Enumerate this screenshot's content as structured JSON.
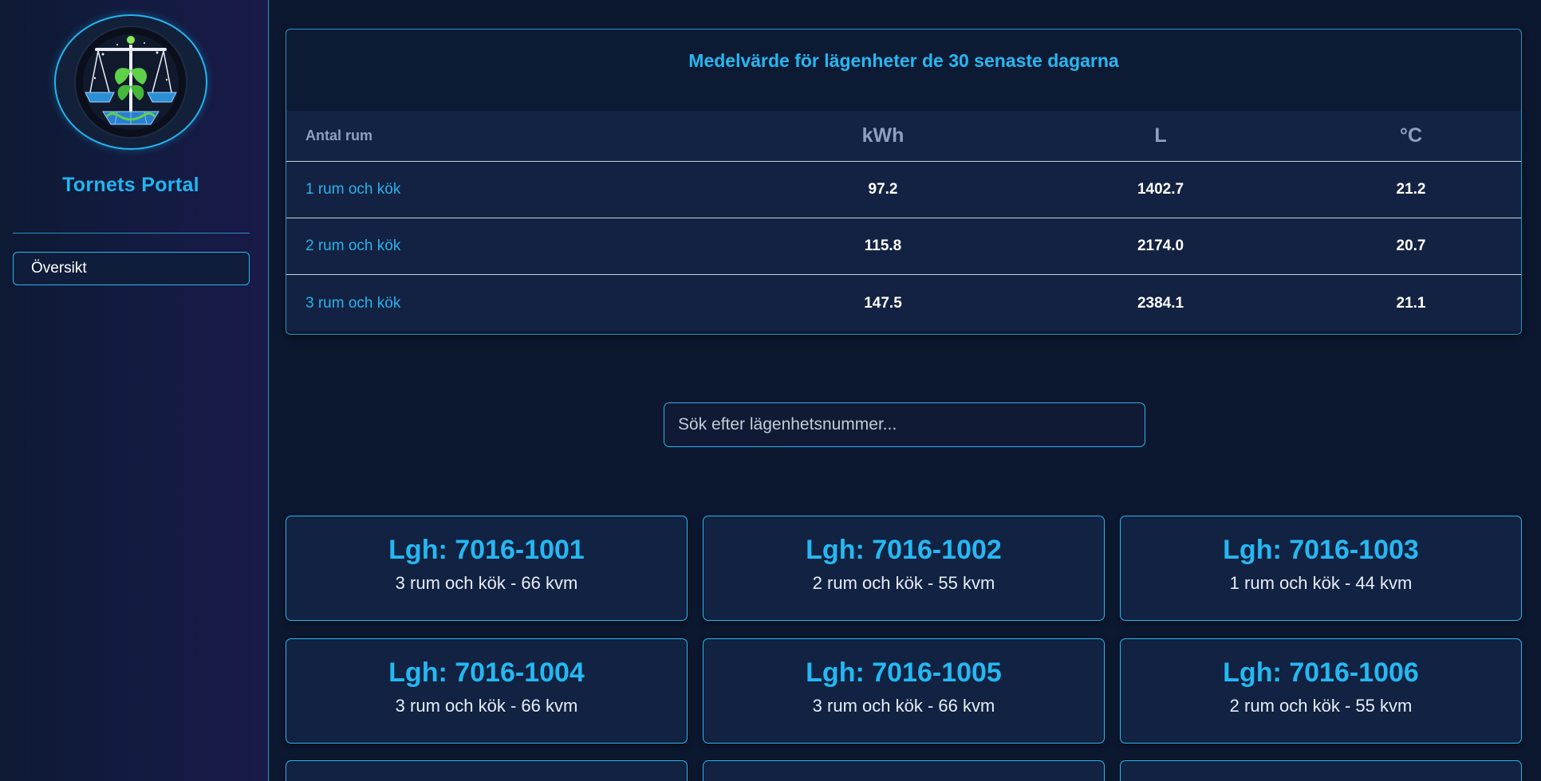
{
  "sidebar": {
    "logo_icon": "scales-leaves-solar-icon",
    "brand": "Tornets Portal",
    "nav": [
      {
        "label": "Översikt"
      }
    ]
  },
  "summary_table": {
    "title": "Medelvärde för lägenheter de 30 senaste dagarna",
    "headers": [
      "Antal rum",
      "kWh",
      "L",
      "°C"
    ],
    "rows": [
      {
        "rooms": "1 rum och kök",
        "kwh": "97.2",
        "liters": "1402.7",
        "celsius": "21.2"
      },
      {
        "rooms": "2 rum och kök",
        "kwh": "115.8",
        "liters": "2174.0",
        "celsius": "20.7"
      },
      {
        "rooms": "3 rum och kök",
        "kwh": "147.5",
        "liters": "2384.1",
        "celsius": "21.1"
      }
    ]
  },
  "search": {
    "placeholder": "Sök efter lägenhetsnummer...",
    "value": ""
  },
  "apartments": [
    {
      "title": "Lgh: 7016-1001",
      "desc": "3 rum och kök - 66 kvm"
    },
    {
      "title": "Lgh: 7016-1002",
      "desc": "2 rum och kök - 55 kvm"
    },
    {
      "title": "Lgh: 7016-1003",
      "desc": "1 rum och kök - 44 kvm"
    },
    {
      "title": "Lgh: 7016-1004",
      "desc": "3 rum och kök - 66 kvm"
    },
    {
      "title": "Lgh: 7016-1005",
      "desc": "3 rum och kök - 66 kvm"
    },
    {
      "title": "Lgh: 7016-1006",
      "desc": "2 rum och kök - 55 kvm"
    }
  ],
  "colors": {
    "accent": "#22b6f0",
    "background": "#0c1830",
    "card": "#112242",
    "border": "#2bb4ee"
  }
}
